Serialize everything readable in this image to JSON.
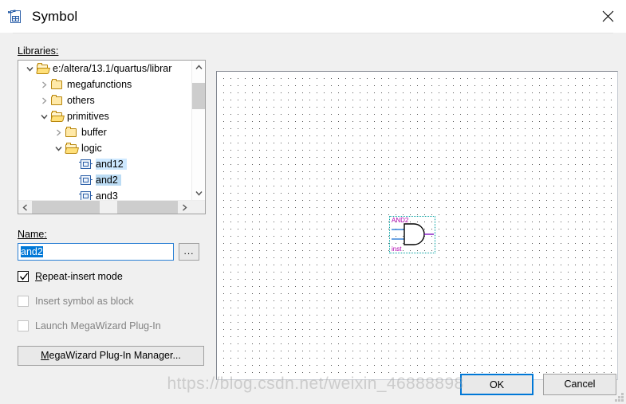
{
  "window": {
    "title": "Symbol",
    "icon": "symbol-file-icon",
    "close_label": "✕"
  },
  "libraries": {
    "label": "Libraries:",
    "tree": [
      {
        "label": "e:/altera/13.1/quartus/librar",
        "depth": 0,
        "type": "folder-open",
        "expanded": true,
        "selected": false
      },
      {
        "label": "megafunctions",
        "depth": 1,
        "type": "folder",
        "expanded": false,
        "selected": false
      },
      {
        "label": "others",
        "depth": 1,
        "type": "folder",
        "expanded": false,
        "selected": false
      },
      {
        "label": "primitives",
        "depth": 1,
        "type": "folder-open",
        "expanded": true,
        "selected": false
      },
      {
        "label": "buffer",
        "depth": 2,
        "type": "folder",
        "expanded": false,
        "selected": false
      },
      {
        "label": "logic",
        "depth": 2,
        "type": "folder-open",
        "expanded": true,
        "selected": false
      },
      {
        "label": "and12",
        "depth": 3,
        "type": "symbol",
        "expanded": null,
        "selected": true
      },
      {
        "label": "and2",
        "depth": 3,
        "type": "symbol",
        "expanded": null,
        "selected": true
      },
      {
        "label": "and3",
        "depth": 3,
        "type": "symbol",
        "expanded": null,
        "selected": false
      }
    ]
  },
  "name_field": {
    "label": "Name:",
    "value": "and2",
    "placeholder": "",
    "browse_label": "...",
    "browse_icon": "ellipsis-icon"
  },
  "options": [
    {
      "label": "Repeat-insert mode",
      "checked": true,
      "enabled": true
    },
    {
      "label": "Insert symbol as block",
      "checked": false,
      "enabled": false
    },
    {
      "label": "Launch MegaWizard Plug-In",
      "checked": false,
      "enabled": false
    }
  ],
  "megawizard_button": {
    "label": "MegaWizard Plug-In Manager..."
  },
  "preview": {
    "symbol_name": "AND2",
    "instance_name": "inst",
    "gate_type": "and-gate",
    "input_count": 2,
    "output_count": 1,
    "colors": {
      "label": "#b000b0",
      "input_pin": "#1a6fd4",
      "output_pin": "#7a00c0",
      "selection": "#00a0a0",
      "body": "#000000"
    }
  },
  "footer": {
    "ok_label": "OK",
    "cancel_label": "Cancel",
    "accent": "#0078d7"
  },
  "watermark": {
    "text": "https://blog.csdn.net/weixin_46888898"
  }
}
